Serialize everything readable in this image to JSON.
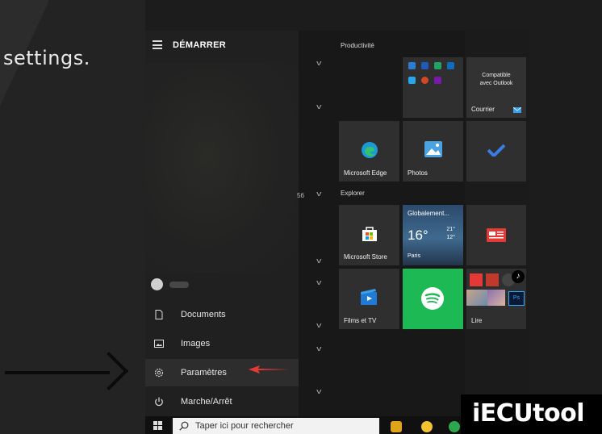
{
  "background_text": "settings.",
  "start_menu": {
    "title": "DÉMARRER",
    "items": [
      {
        "label": "Documents",
        "icon": "document-icon"
      },
      {
        "label": "Images",
        "icon": "image-icon"
      },
      {
        "label": "Paramètres",
        "icon": "gear-icon"
      },
      {
        "label": "Marche/Arrêt",
        "icon": "power-icon"
      }
    ]
  },
  "tiles": {
    "group1_label": "Productivité",
    "group2_label": "Explorer",
    "outlook_line1": "Compatible",
    "outlook_line2": "avec Outlook",
    "courrier": "Courrier",
    "edge": "Microsoft Edge",
    "photos": "Photos",
    "weather_title": "Globalement...",
    "weather_temp": "16°",
    "weather_hi": "21°",
    "weather_lo": "12°",
    "weather_city": "Paris",
    "store": "Microsoft Store",
    "films": "Films et TV",
    "play": "Lire"
  },
  "stray_text": "56",
  "taskbar": {
    "search_placeholder": "Taper ici pour rechercher"
  },
  "watermark": "iECUtool",
  "colors": {
    "accent_red": "#e53935",
    "spotify_green": "#1db954",
    "edge_blue": "#1a9bd7",
    "tile_gray": "#2f2f2f"
  }
}
